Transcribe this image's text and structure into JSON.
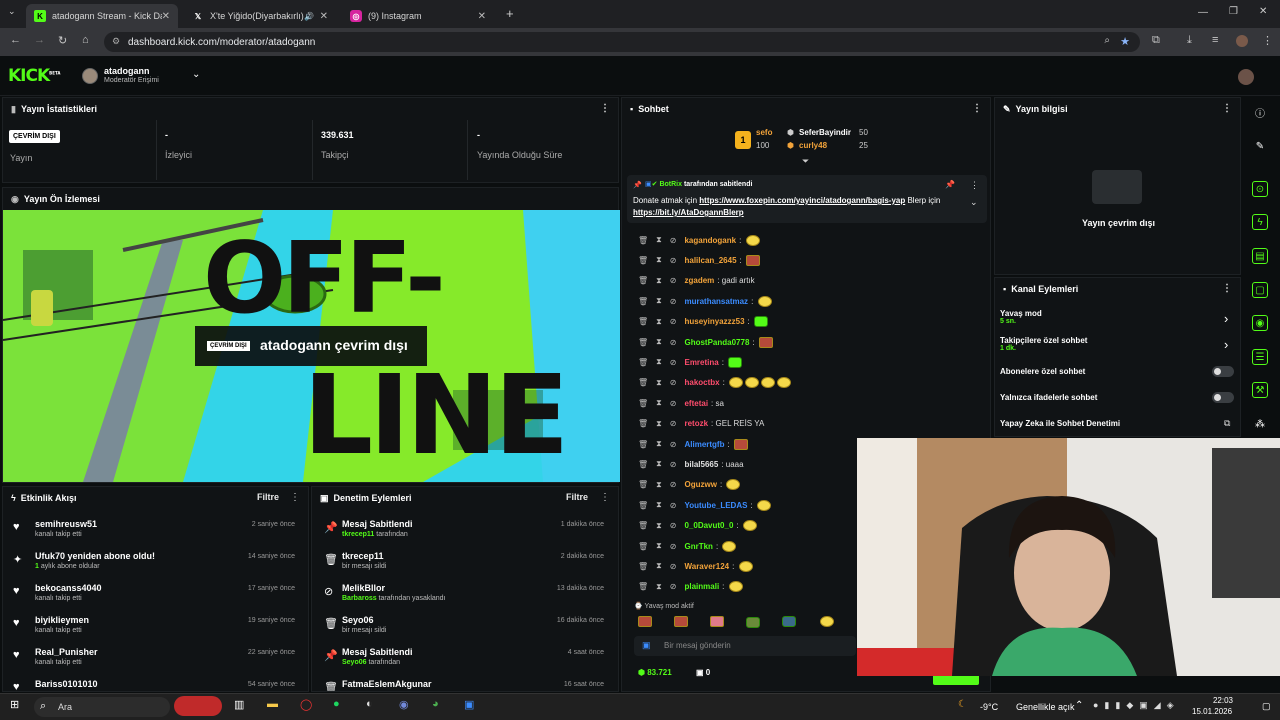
{
  "browser": {
    "tabs": [
      {
        "title": "atadogann Stream - Kick Dashb",
        "active": true
      },
      {
        "title": "X'te Yiğido(Diyarbakırlı) #İS"
      },
      {
        "title": "(9) Instagram"
      }
    ],
    "url": "dashboard.kick.com/moderator/atadogann",
    "new_tab": "+"
  },
  "header": {
    "logo": "KICK",
    "logo_badge": "BETA",
    "user_name": "atadogann",
    "user_role": "Moderatör Erişimi"
  },
  "stats": {
    "title": "Yayın İstatistikleri",
    "status_badge": "ÇEVRİM DIŞI",
    "status_label": "Yayın",
    "viewers_value": "-",
    "viewers_label": "İzleyici",
    "followers_value": "339.631",
    "followers_label": "Takipçi",
    "uptime_value": "-",
    "uptime_label": "Yayında Olduğu Süre"
  },
  "preview": {
    "title": "Yayın Ön İzlemesi",
    "badge": "ÇEVRİM DIŞI",
    "caption": "atadogann çevrim dışı",
    "bg_word_1": "OFF-",
    "bg_word_2": "LINE"
  },
  "activity": {
    "title": "Etkinlik Akışı",
    "filter": "Filtre",
    "items": [
      {
        "name": "semihreusw51",
        "sub": "kanalı takip etti",
        "time": "2 saniye önce",
        "icon": "heart-icon"
      },
      {
        "name": "Ufuk70 yeniden abone oldu!",
        "sub_count": "1",
        "sub": " aylık abone oldular",
        "time": "14 saniye önce",
        "icon": "star-icon"
      },
      {
        "name": "bekocanss4040",
        "sub": "kanalı takip etti",
        "time": "17 saniye önce",
        "icon": "heart-icon"
      },
      {
        "name": "biyiklieymen",
        "sub": "kanalı takip etti",
        "time": "19 saniye önce",
        "icon": "heart-icon"
      },
      {
        "name": "Real_Punisher",
        "sub": "kanalı takip etti",
        "time": "22 saniye önce",
        "icon": "heart-icon"
      },
      {
        "name": "Bariss0101010",
        "sub": "",
        "time": "54 saniye önce",
        "icon": "heart-icon"
      }
    ]
  },
  "moderation": {
    "title": "Denetim Eylemleri",
    "filter": "Filtre",
    "items": [
      {
        "name": "Mesaj Sabitlendi",
        "actor": "tkrecep11",
        "sub": " tarafından",
        "time": "1 dakika önce",
        "icon": "pin-icon"
      },
      {
        "name": "tkrecep11",
        "actor": "",
        "sub": "bir mesajı sildi",
        "time": "2 dakika önce",
        "icon": "trash-icon"
      },
      {
        "name": "MelikBllor",
        "actor": "Barbaross",
        "sub": " tarafından yasaklandı",
        "time": "13 dakika önce",
        "icon": "ban-icon"
      },
      {
        "name": "Seyo06",
        "actor": "",
        "sub": "bir mesajı sildi",
        "time": "16 dakika önce",
        "icon": "trash-icon"
      },
      {
        "name": "Mesaj Sabitlendi",
        "actor": "Seyo06",
        "sub": " tarafından",
        "time": "4 saat önce",
        "icon": "pin-icon"
      },
      {
        "name": "FatmaEslemAkgunar",
        "actor": "",
        "sub": "",
        "time": "16 saat önce",
        "icon": "trash-icon"
      }
    ]
  },
  "chat": {
    "title": "Sohbet",
    "leaders": [
      {
        "rank": "1",
        "name": "sefo",
        "score": "100"
      },
      {
        "name": "SeferBayindir",
        "score": "50"
      },
      {
        "name": "curly48",
        "score": "25"
      }
    ],
    "pinned_by": "BotRix",
    "pinned_suffix": " tarafından sabitlendi",
    "pinned_text_1": "Donate atmak için ",
    "pinned_link_1": "https://www.foxepin.com/yayinci/atadogann/bagis-yap",
    "pinned_text_2": " Blerp için ",
    "pinned_link_2": "https://bit.ly/AtaDogannBlerp",
    "messages": [
      {
        "user": "kagandogank",
        "color": "#f2a33a",
        "text": "",
        "emotes": [
          "y"
        ]
      },
      {
        "user": "halilcan_2645",
        "color": "#f2a33a",
        "text": "",
        "emotes": [
          "r"
        ]
      },
      {
        "user": "zgadem",
        "color": "#f2a33a",
        "text": "gadi artık",
        "emotes": []
      },
      {
        "user": "murathansatmaz",
        "color": "#3b8cff",
        "text": "",
        "emotes": [
          "y"
        ]
      },
      {
        "user": "huseyinyazzz53",
        "color": "#f2a33a",
        "text": "",
        "emotes": [
          "g"
        ]
      },
      {
        "user": "GhostPanda0778",
        "color": "#53fc18",
        "text": "",
        "emotes": [
          "r"
        ]
      },
      {
        "user": "Emretina",
        "color": "#ff4d6d",
        "text": "",
        "emotes": [
          "g"
        ]
      },
      {
        "user": "hakoctbx",
        "color": "#ff4d6d",
        "text": "",
        "emotes": [
          "y",
          "y",
          "y",
          "y"
        ]
      },
      {
        "user": "eftetai",
        "color": "#ff4d6d",
        "text": "sa",
        "emotes": []
      },
      {
        "user": "retozk",
        "color": "#ff4d6d",
        "text": "GEL REİS YA",
        "emotes": []
      },
      {
        "user": "Alimertgfb",
        "color": "#3b8cff",
        "text": "",
        "emotes": [
          "r"
        ]
      },
      {
        "user": "bilal5665",
        "color": "#e0e0e0",
        "text": "uaaa",
        "emotes": []
      },
      {
        "user": "Oguzww",
        "color": "#f2a33a",
        "text": "",
        "emotes": [
          "y"
        ]
      },
      {
        "user": "Youtube_LEDAS",
        "color": "#3b8cff",
        "text": "",
        "emotes": [
          "y"
        ]
      },
      {
        "user": "0_0Davut0_0",
        "color": "#53fc18",
        "text": "",
        "emotes": [
          "y"
        ]
      },
      {
        "user": "GnrTkn",
        "color": "#53fc18",
        "text": "",
        "emotes": [
          "y"
        ]
      },
      {
        "user": "Waraver124",
        "color": "#f2a33a",
        "text": "",
        "emotes": [
          "y"
        ]
      },
      {
        "user": "plainmali",
        "color": "#53fc18",
        "text": "",
        "emotes": [
          "y"
        ]
      }
    ],
    "slow_mode": "Yavaş mod aktif",
    "input_placeholder": "Bir mesaj gönderin",
    "points": "83.721",
    "other_count": "0"
  },
  "stream_info": {
    "title": "Yayın bilgisi",
    "offline": "Yayın çevrim dışı"
  },
  "channel_actions": {
    "title": "Kanal Eylemleri",
    "items": [
      {
        "label": "Yavaş mod",
        "sub": "5 sn."
      },
      {
        "label": "Takipçilere özel sohbet",
        "sub": "1 dk."
      },
      {
        "label": "Abonelere özel sohbet",
        "sub": ""
      },
      {
        "label": "Yalnızca ifadelerle sohbet",
        "sub": ""
      },
      {
        "label": "Yapay Zeka ile Sohbet Denetimi",
        "sub": ""
      }
    ]
  },
  "taskbar": {
    "search": "Ara",
    "weather": "-9°C",
    "weather_desc": "Genellikle açık",
    "time": "22:03",
    "date": "15.01.2026"
  },
  "colors": {
    "accent": "#53fc18",
    "bg": "#0b0e0f",
    "panel": "#101315"
  }
}
